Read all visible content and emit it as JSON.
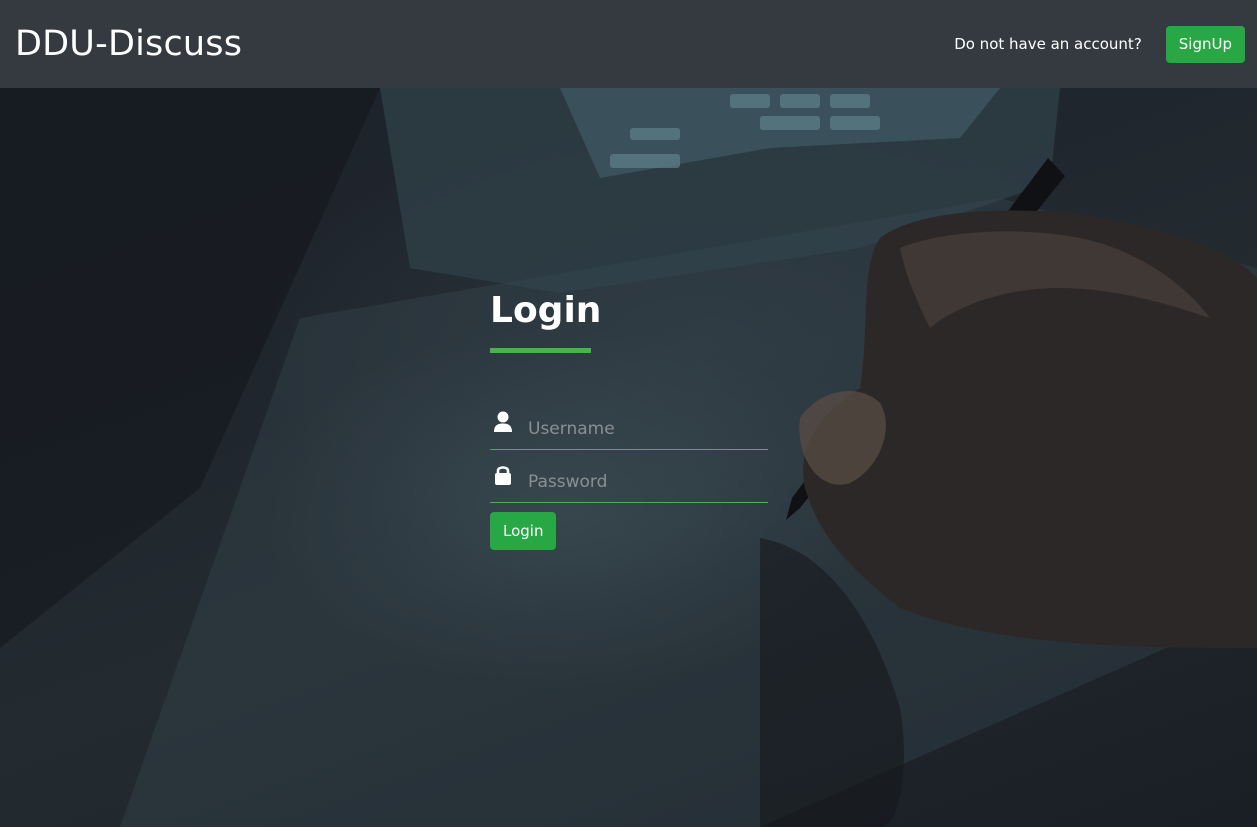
{
  "navbar": {
    "brand": "DDU-Discuss",
    "prompt_text": "Do not have an account?",
    "signup_label": "SignUp"
  },
  "login": {
    "title": "Login",
    "username_placeholder": "Username",
    "password_placeholder": "Password",
    "submit_label": "Login"
  },
  "colors": {
    "accent": "#28a745",
    "underline": "#4caf50",
    "navbar_bg": "#343a40"
  },
  "icons": {
    "username": "user-icon",
    "password": "lock-icon"
  }
}
